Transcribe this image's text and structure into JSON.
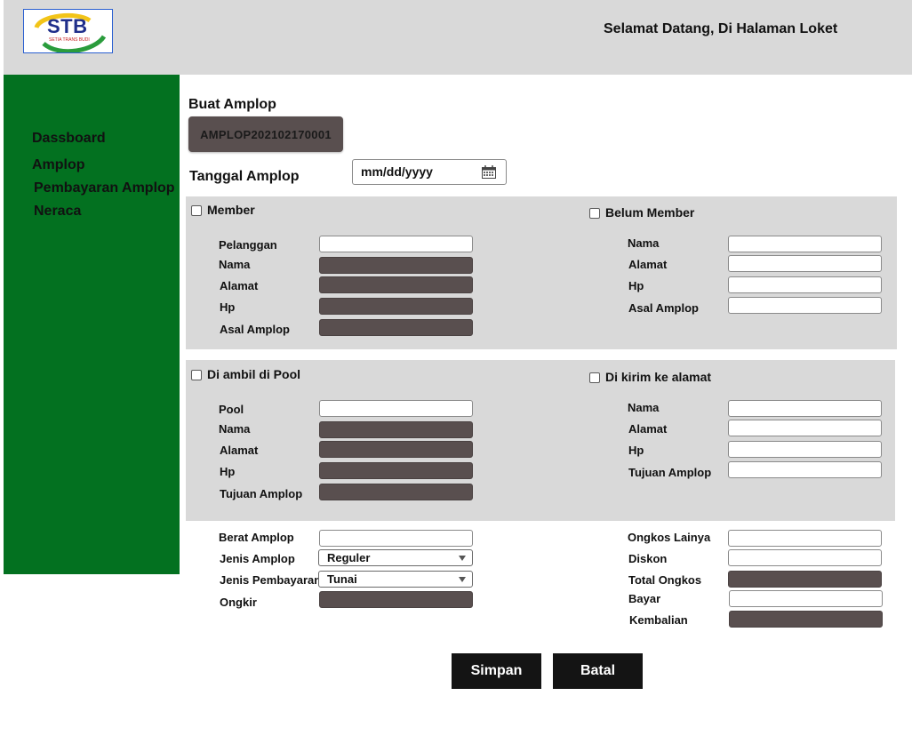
{
  "header": {
    "logo_text": "STB",
    "logo_subtext": "SETIA TRANS BUDI",
    "welcome": "Selamat Datang, Di Halaman Loket"
  },
  "sidebar": {
    "items": [
      {
        "label": "Dassboard"
      },
      {
        "label": "Amplop"
      },
      {
        "label": "Pembayaran Amplop"
      },
      {
        "label": "Neraca"
      }
    ]
  },
  "form": {
    "title": "Buat Amplop",
    "code": "AMPLOP202102170001",
    "date_label": "Tanggal Amplop",
    "date_placeholder": "mm/dd/yyyy",
    "sender_member": {
      "checkbox_label": "Member",
      "fields": [
        "Pelanggan",
        "Nama",
        "Alamat",
        "Hp",
        "Asal Amplop"
      ]
    },
    "sender_non_member": {
      "checkbox_label": "Belum Member",
      "fields": [
        "Nama",
        "Alamat",
        "Hp",
        "Asal Amplop"
      ]
    },
    "pickup_pool": {
      "checkbox_label": "Di ambil di Pool",
      "fields": [
        "Pool",
        "Nama",
        "Alamat",
        "Hp",
        "Tujuan Amplop"
      ]
    },
    "delivery_address": {
      "checkbox_label": "Di kirim ke alamat",
      "fields": [
        "Nama",
        "Alamat",
        "Hp",
        "Tujuan Amplop"
      ]
    },
    "details_left": {
      "berat_label": "Berat Amplop",
      "jenis_amplop_label": "Jenis Amplop",
      "jenis_amplop_value": "Reguler",
      "jenis_pembayaran_label": "Jenis Pembayaran",
      "jenis_pembayaran_value": "Tunai",
      "ongkir_label": "Ongkir"
    },
    "details_right": {
      "ongkos_lainya_label": "Ongkos Lainya",
      "diskon_label": "Diskon",
      "total_ongkos_label": "Total Ongkos",
      "bayar_label": "Bayar",
      "kembalian_label": "Kembalian"
    },
    "buttons": {
      "save": "Simpan",
      "cancel": "Batal"
    }
  },
  "colors": {
    "sidebar": "#037120",
    "header": "#d9d9d9",
    "panel": "#d9d9d9",
    "readonly_field": "#594f4f",
    "button": "#141414"
  }
}
